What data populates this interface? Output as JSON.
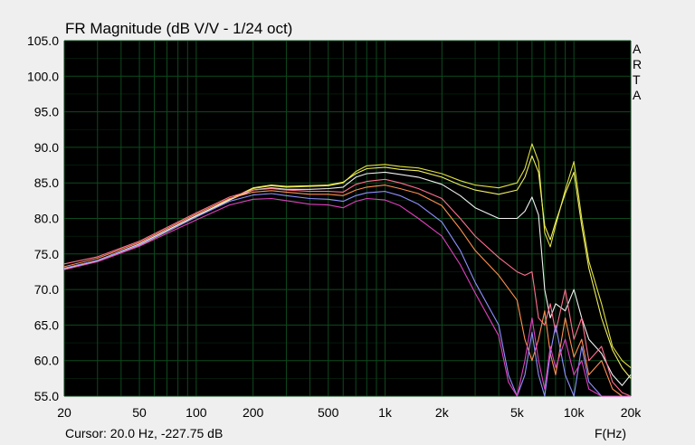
{
  "chart_data": {
    "type": "line",
    "title": "FR Magnitude (dB V/V - 1/24 oct)",
    "xlabel": "F(Hz)",
    "ylabel": "",
    "xscale": "log",
    "xlim": [
      20,
      20000
    ],
    "ylim": [
      55.0,
      105.0
    ],
    "y_ticks": [
      "105.0",
      "100.0",
      "95.0",
      "90.0",
      "85.0",
      "80.0",
      "75.0",
      "70.0",
      "65.0",
      "60.0",
      "55.0"
    ],
    "x_ticks": [
      {
        "value": 20,
        "label": "20"
      },
      {
        "value": 50,
        "label": "50"
      },
      {
        "value": 100,
        "label": "100"
      },
      {
        "value": 200,
        "label": "200"
      },
      {
        "value": 500,
        "label": "500"
      },
      {
        "value": 1000,
        "label": "1k"
      },
      {
        "value": 2000,
        "label": "2k"
      },
      {
        "value": 5000,
        "label": "5k"
      },
      {
        "value": 10000,
        "label": "10k"
      },
      {
        "value": 20000,
        "label": "20k"
      }
    ],
    "grid": true,
    "plot_background": "#000000",
    "grid_color": "#0e4a1e",
    "series": [
      {
        "color": "#e0e040",
        "points": [
          [
            20,
            72.8
          ],
          [
            30,
            74.0
          ],
          [
            50,
            76.2
          ],
          [
            100,
            80.2
          ],
          [
            150,
            82.6
          ],
          [
            200,
            84.2
          ],
          [
            250,
            84.6
          ],
          [
            300,
            84.4
          ],
          [
            400,
            84.5
          ],
          [
            500,
            84.6
          ],
          [
            600,
            85.0
          ],
          [
            700,
            86.6
          ],
          [
            800,
            87.4
          ],
          [
            1000,
            87.6
          ],
          [
            1200,
            87.3
          ],
          [
            1500,
            87.1
          ],
          [
            2000,
            86.3
          ],
          [
            2500,
            85.3
          ],
          [
            3000,
            84.7
          ],
          [
            4000,
            84.3
          ],
          [
            5000,
            85.0
          ],
          [
            5500,
            87.0
          ],
          [
            6000,
            90.5
          ],
          [
            6500,
            88.0
          ],
          [
            7000,
            78.0
          ],
          [
            7500,
            76.0
          ],
          [
            8000,
            79.0
          ],
          [
            9000,
            84.0
          ],
          [
            10000,
            88.0
          ],
          [
            11000,
            80.0
          ],
          [
            12000,
            74.0
          ],
          [
            14000,
            68.0
          ],
          [
            16000,
            62.0
          ],
          [
            18000,
            60.0
          ],
          [
            20000,
            59.0
          ]
        ]
      },
      {
        "color": "#f0f060",
        "points": [
          [
            20,
            72.9
          ],
          [
            30,
            74.1
          ],
          [
            50,
            76.3
          ],
          [
            100,
            80.3
          ],
          [
            150,
            82.7
          ],
          [
            200,
            84.3
          ],
          [
            250,
            84.7
          ],
          [
            300,
            84.5
          ],
          [
            400,
            84.6
          ],
          [
            500,
            84.7
          ],
          [
            600,
            85.1
          ],
          [
            700,
            86.3
          ],
          [
            800,
            87.0
          ],
          [
            1000,
            87.2
          ],
          [
            1200,
            86.9
          ],
          [
            1500,
            86.7
          ],
          [
            2000,
            85.8
          ],
          [
            2500,
            84.7
          ],
          [
            3000,
            84.0
          ],
          [
            4000,
            83.4
          ],
          [
            5000,
            84.0
          ],
          [
            5500,
            85.8
          ],
          [
            6000,
            88.8
          ],
          [
            6500,
            86.5
          ],
          [
            7000,
            79.0
          ],
          [
            7500,
            77.0
          ],
          [
            8000,
            79.5
          ],
          [
            9000,
            83.5
          ],
          [
            10000,
            86.5
          ],
          [
            11000,
            79.0
          ],
          [
            12000,
            73.0
          ],
          [
            14000,
            66.0
          ],
          [
            16000,
            61.5
          ],
          [
            18000,
            59.0
          ],
          [
            20000,
            57.5
          ]
        ]
      },
      {
        "color": "#f2f2f2",
        "points": [
          [
            20,
            73.0
          ],
          [
            30,
            74.1
          ],
          [
            50,
            76.4
          ],
          [
            100,
            80.4
          ],
          [
            150,
            82.6
          ],
          [
            200,
            84.0
          ],
          [
            250,
            84.3
          ],
          [
            300,
            84.1
          ],
          [
            400,
            84.1
          ],
          [
            500,
            84.2
          ],
          [
            600,
            84.4
          ],
          [
            700,
            85.8
          ],
          [
            800,
            86.3
          ],
          [
            1000,
            86.5
          ],
          [
            1200,
            86.2
          ],
          [
            1500,
            85.8
          ],
          [
            2000,
            84.8
          ],
          [
            2500,
            83.2
          ],
          [
            3000,
            81.5
          ],
          [
            4000,
            80.0
          ],
          [
            5000,
            80.0
          ],
          [
            5500,
            81.0
          ],
          [
            6000,
            83.0
          ],
          [
            6500,
            80.5
          ],
          [
            7000,
            70.0
          ],
          [
            7500,
            66.0
          ],
          [
            8000,
            68.0
          ],
          [
            9000,
            67.0
          ],
          [
            10000,
            70.0
          ],
          [
            11000,
            66.0
          ],
          [
            12000,
            63.0
          ],
          [
            14000,
            61.0
          ],
          [
            16000,
            58.0
          ],
          [
            18000,
            56.5
          ],
          [
            20000,
            58.0
          ]
        ]
      },
      {
        "color": "#ff7090",
        "points": [
          [
            20,
            73.6
          ],
          [
            30,
            74.6
          ],
          [
            50,
            76.8
          ],
          [
            100,
            80.8
          ],
          [
            150,
            83.0
          ],
          [
            200,
            84.0
          ],
          [
            250,
            84.2
          ],
          [
            300,
            84.0
          ],
          [
            400,
            83.8
          ],
          [
            500,
            83.8
          ],
          [
            600,
            83.7
          ],
          [
            700,
            84.8
          ],
          [
            800,
            85.2
          ],
          [
            1000,
            85.5
          ],
          [
            1200,
            85.0
          ],
          [
            1500,
            84.2
          ],
          [
            2000,
            82.8
          ],
          [
            2500,
            80.0
          ],
          [
            3000,
            77.5
          ],
          [
            4000,
            74.5
          ],
          [
            5000,
            72.5
          ],
          [
            5500,
            72.0
          ],
          [
            6000,
            72.5
          ],
          [
            6500,
            66.0
          ],
          [
            7000,
            65.0
          ],
          [
            7500,
            68.0
          ],
          [
            8000,
            64.0
          ],
          [
            9000,
            70.0
          ],
          [
            10000,
            63.0
          ],
          [
            11000,
            66.0
          ],
          [
            12000,
            60.0
          ],
          [
            14000,
            62.0
          ],
          [
            16000,
            57.0
          ],
          [
            18000,
            55.5
          ],
          [
            20000,
            55.0
          ]
        ]
      },
      {
        "color": "#ff9050",
        "points": [
          [
            20,
            73.2
          ],
          [
            30,
            74.4
          ],
          [
            50,
            76.6
          ],
          [
            100,
            80.6
          ],
          [
            150,
            82.8
          ],
          [
            200,
            83.7
          ],
          [
            250,
            83.9
          ],
          [
            300,
            83.7
          ],
          [
            400,
            83.4
          ],
          [
            500,
            83.4
          ],
          [
            600,
            83.2
          ],
          [
            700,
            84.0
          ],
          [
            800,
            84.4
          ],
          [
            1000,
            84.7
          ],
          [
            1200,
            84.2
          ],
          [
            1500,
            83.5
          ],
          [
            2000,
            81.8
          ],
          [
            2500,
            78.5
          ],
          [
            3000,
            75.5
          ],
          [
            4000,
            72.0
          ],
          [
            5000,
            68.5
          ],
          [
            5500,
            63.0
          ],
          [
            6000,
            60.0
          ],
          [
            6500,
            63.0
          ],
          [
            7000,
            67.0
          ],
          [
            7500,
            61.0
          ],
          [
            8000,
            58.0
          ],
          [
            9000,
            66.0
          ],
          [
            10000,
            60.5
          ],
          [
            11000,
            63.0
          ],
          [
            12000,
            58.0
          ],
          [
            14000,
            60.0
          ],
          [
            16000,
            56.0
          ],
          [
            18000,
            55.0
          ],
          [
            20000,
            55.0
          ]
        ]
      },
      {
        "color": "#9090ff",
        "points": [
          [
            20,
            73.0
          ],
          [
            30,
            74.1
          ],
          [
            50,
            76.3
          ],
          [
            100,
            80.2
          ],
          [
            150,
            82.4
          ],
          [
            200,
            83.3
          ],
          [
            250,
            83.5
          ],
          [
            300,
            83.2
          ],
          [
            400,
            82.8
          ],
          [
            500,
            82.7
          ],
          [
            600,
            82.4
          ],
          [
            700,
            83.2
          ],
          [
            800,
            83.6
          ],
          [
            1000,
            83.8
          ],
          [
            1200,
            83.2
          ],
          [
            1500,
            82.0
          ],
          [
            2000,
            79.5
          ],
          [
            2500,
            75.5
          ],
          [
            3000,
            71.0
          ],
          [
            4000,
            65.0
          ],
          [
            4500,
            58.0
          ],
          [
            5000,
            55.0
          ],
          [
            5500,
            58.0
          ],
          [
            6000,
            64.0
          ],
          [
            6500,
            58.0
          ],
          [
            7000,
            55.0
          ],
          [
            7500,
            61.0
          ],
          [
            8000,
            65.0
          ],
          [
            9000,
            58.0
          ],
          [
            10000,
            55.0
          ],
          [
            11000,
            62.0
          ],
          [
            12000,
            57.0
          ],
          [
            14000,
            55.0
          ],
          [
            16000,
            55.0
          ],
          [
            18000,
            55.0
          ],
          [
            20000,
            55.0
          ]
        ]
      },
      {
        "color": "#e040c0",
        "points": [
          [
            20,
            72.8
          ],
          [
            30,
            73.9
          ],
          [
            50,
            76.1
          ],
          [
            100,
            79.8
          ],
          [
            150,
            81.9
          ],
          [
            200,
            82.7
          ],
          [
            250,
            82.8
          ],
          [
            300,
            82.5
          ],
          [
            400,
            82.0
          ],
          [
            500,
            81.9
          ],
          [
            600,
            81.5
          ],
          [
            700,
            82.4
          ],
          [
            800,
            82.8
          ],
          [
            1000,
            82.6
          ],
          [
            1200,
            81.8
          ],
          [
            1500,
            80.0
          ],
          [
            2000,
            77.5
          ],
          [
            2500,
            73.5
          ],
          [
            3000,
            69.5
          ],
          [
            4000,
            63.5
          ],
          [
            4500,
            57.0
          ],
          [
            5000,
            55.0
          ],
          [
            5500,
            60.0
          ],
          [
            6000,
            66.0
          ],
          [
            6500,
            60.0
          ],
          [
            7000,
            56.0
          ],
          [
            7500,
            62.0
          ],
          [
            8000,
            59.0
          ],
          [
            9000,
            63.0
          ],
          [
            10000,
            58.0
          ],
          [
            11000,
            60.0
          ],
          [
            12000,
            56.0
          ],
          [
            14000,
            55.0
          ],
          [
            16000,
            55.0
          ],
          [
            18000,
            55.0
          ],
          [
            20000,
            55.0
          ]
        ]
      }
    ]
  },
  "brand_letters": [
    "A",
    "R",
    "T",
    "A"
  ],
  "status": {
    "cursor_text": "Cursor: 20.0 Hz, -227.75 dB"
  }
}
